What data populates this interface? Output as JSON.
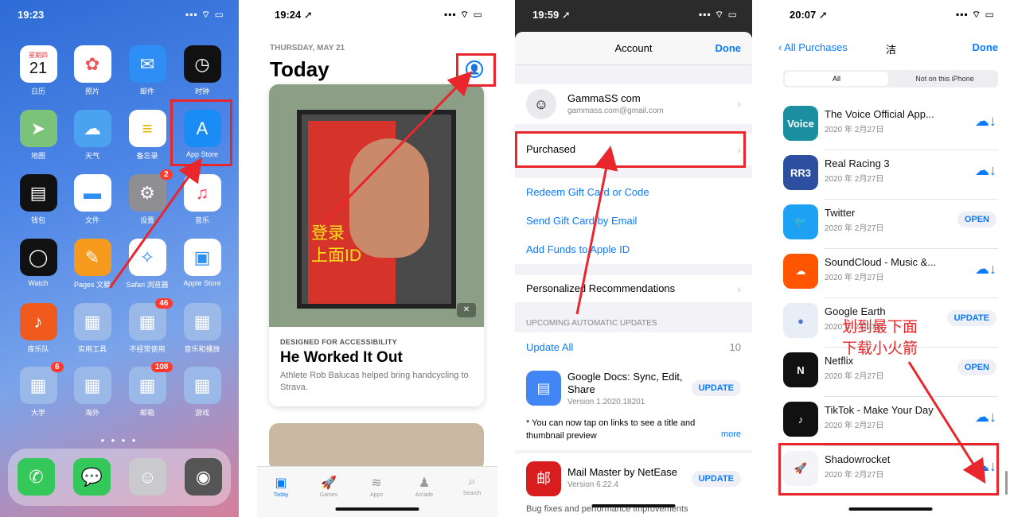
{
  "phone1": {
    "time": "19:23",
    "status_icons": "▪▪▪ ⌔ ▭",
    "apps": [
      {
        "label": "日历",
        "glyph": "21",
        "sub": "星期四",
        "color": "#ffffff",
        "text": "#111"
      },
      {
        "label": "照片",
        "glyph": "✿",
        "color": "#ffffff",
        "text": "#e55"
      },
      {
        "label": "邮件",
        "glyph": "✉",
        "color": "#2f8df6",
        "text": "#fff"
      },
      {
        "label": "时钟",
        "glyph": "◷",
        "color": "#111111",
        "text": "#fff"
      },
      {
        "label": "地图",
        "glyph": "➤",
        "color": "#7cc37a",
        "text": "#fff"
      },
      {
        "label": "天气",
        "glyph": "☁",
        "color": "#4ba3ef",
        "text": "#fff"
      },
      {
        "label": "备忘录",
        "glyph": "≡",
        "color": "#ffffff",
        "text": "#e9b400"
      },
      {
        "label": "App Store",
        "glyph": "A",
        "color": "#1a8cf5",
        "text": "#fff"
      },
      {
        "label": "钱包",
        "glyph": "▤",
        "color": "#111111",
        "text": "#fff"
      },
      {
        "label": "文件",
        "glyph": "▬",
        "color": "#ffffff",
        "text": "#2f8df6"
      },
      {
        "label": "设置",
        "glyph": "⚙",
        "color": "#8e8e93",
        "text": "#fff",
        "badge": "2"
      },
      {
        "label": "音乐",
        "glyph": "♫",
        "color": "#ffffff",
        "text": "#fa3a57"
      },
      {
        "label": "Watch",
        "glyph": "◯",
        "color": "#111111",
        "text": "#fff"
      },
      {
        "label": "Pages 文稿",
        "glyph": "✎",
        "color": "#f69a1d",
        "text": "#fff"
      },
      {
        "label": "Safari 浏览器",
        "glyph": "✧",
        "color": "#ffffff",
        "text": "#2f8df6"
      },
      {
        "label": "Apple Store",
        "glyph": "▣",
        "color": "#ffffff",
        "text": "#2f8df6"
      },
      {
        "label": "库乐队",
        "glyph": "♪",
        "color": "#f05a1d",
        "text": "#fff"
      },
      {
        "label": "实用工具",
        "glyph": "▦",
        "color": "#9ab8e8",
        "text": "#fff"
      },
      {
        "label": "不经常使用",
        "glyph": "▦",
        "color": "#9ab8e8",
        "text": "#fff",
        "badge": "46"
      },
      {
        "label": "音乐和播放",
        "glyph": "▦",
        "color": "#9ab8e8",
        "text": "#fff"
      },
      {
        "label": "大学",
        "glyph": "▦",
        "color": "#9ab8e8",
        "text": "#fff",
        "badge": "6"
      },
      {
        "label": "海外",
        "glyph": "▦",
        "color": "#9ab8e8",
        "text": "#fff"
      },
      {
        "label": "邮箱",
        "glyph": "▦",
        "color": "#9ab8e8",
        "text": "#fff",
        "badge": "108"
      },
      {
        "label": "游戏",
        "glyph": "▦",
        "color": "#9ab8e8",
        "text": "#fff"
      }
    ],
    "dock": [
      {
        "icon": "phone-icon",
        "glyph": "✆",
        "color": "#34c759"
      },
      {
        "icon": "messages-icon",
        "glyph": "💬",
        "color": "#34c759"
      },
      {
        "icon": "contacts-icon",
        "glyph": "☺",
        "color": "#c9c9ce"
      },
      {
        "icon": "camera-icon",
        "glyph": "◉",
        "color": "#555555"
      }
    ]
  },
  "phone2": {
    "time": "19:24 ➚",
    "status_icons": "▪▪▪ ⌔ ▭",
    "date_label": "THURSDAY, MAY 21",
    "title": "Today",
    "card_kicker": "DESIGNED FOR ACCESSIBILITY",
    "card_title": "He Worked It Out",
    "card_subtitle": "Athlete Rob Balucas helped bring handcycling to Strava.",
    "annotation": [
      "登录",
      "上面ID"
    ],
    "tabs": [
      {
        "label": "Today",
        "glyph": "▣",
        "active": true
      },
      {
        "label": "Games",
        "glyph": "🚀"
      },
      {
        "label": "Apps",
        "glyph": "≋"
      },
      {
        "label": "Arcade",
        "glyph": "♟"
      },
      {
        "label": "Search",
        "glyph": "⌕"
      }
    ]
  },
  "phone3": {
    "time": "19:59 ➚",
    "status_icons": "▪▪▪ ⌔ ▭",
    "nav_title": "Account",
    "done": "Done",
    "user_name": "GammaSS com",
    "user_email": "gammass.com@gmail.com",
    "purchased": "Purchased",
    "links": [
      "Redeem Gift Card or Code",
      "Send Gift Card by Email",
      "Add Funds to Apple ID"
    ],
    "personalized": "Personalized Recommendations",
    "section_upcoming": "UPCOMING AUTOMATIC UPDATES",
    "update_all": "Update All",
    "update_count": "10",
    "app1_name": "Google Docs: Sync, Edit, Share",
    "app1_version": "Version 1.2020.18201",
    "app1_note": "* You can now tap on links to see a title and thumbnail preview",
    "more": "more",
    "app2_name": "Mail Master by NetEase",
    "app2_version": "Version 6.22.4",
    "update_btn": "UPDATE",
    "footer_partial": "Bug fixes and performance improvements"
  },
  "phone4": {
    "time": "20:07 ➚",
    "status_icons": "▪▪▪ ⌔ ▭",
    "back": "All Purchases",
    "title": "洁",
    "done": "Done",
    "seg_all": "All",
    "seg_not": "Not on this iPhone",
    "annotation": [
      "划到最下面",
      "下载小火箭"
    ],
    "rows": [
      {
        "name": "The Voice Official App...",
        "date": "2020 年 2月27日",
        "action": "cloud",
        "icon_text": "Voice",
        "color": "#1a8fa0"
      },
      {
        "name": "Real Racing 3",
        "date": "2020 年 2月27日",
        "action": "cloud",
        "icon_text": "RR3",
        "color": "#2c4fa0"
      },
      {
        "name": "Twitter",
        "date": "2020 年 2月27日",
        "action": "OPEN",
        "icon_text": "🐦",
        "color": "#1da1f2"
      },
      {
        "name": "SoundCloud - Music &...",
        "date": "2020 年 2月27日",
        "action": "cloud",
        "icon_text": "☁",
        "color": "#ff5500"
      },
      {
        "name": "Google Earth",
        "date": "2020 年 2月27日",
        "action": "UPDATE",
        "icon_text": "●",
        "color": "#e8eef8"
      },
      {
        "name": "Netflix",
        "date": "2020 年 2月27日",
        "action": "OPEN",
        "icon_text": "N",
        "color": "#111111"
      },
      {
        "name": "TikTok - Make Your Day",
        "date": "2020 年 2月27日",
        "action": "cloud",
        "icon_text": "♪",
        "color": "#111111"
      },
      {
        "name": "Shadowrocket",
        "date": "2020 年 2月27日",
        "action": "cloud",
        "icon_text": "🚀",
        "color": "#f4f4f8"
      }
    ]
  },
  "colors": {
    "annotation_red": "#e8262b",
    "ios_blue": "#0a7aff",
    "annotation_yellow": "#f5e21b"
  }
}
